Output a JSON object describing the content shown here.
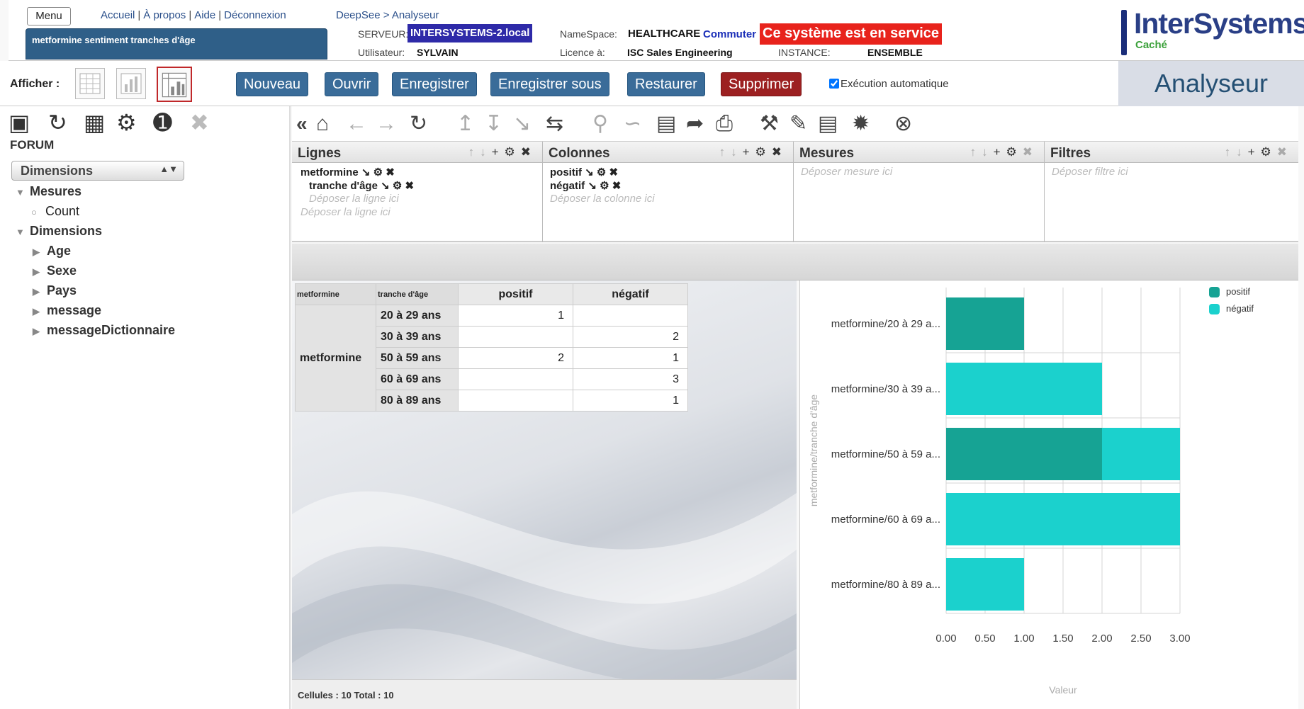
{
  "header": {
    "menu_label": "Menu",
    "links": [
      "Accueil",
      "À propos",
      "Aide",
      "Déconnexion"
    ],
    "title": "metformine sentiment tranches d'âge",
    "breadcrumb": "DeepSee > Analyseur",
    "server_label": "SERVEUR:",
    "server_value": "INTERSYSTEMS-2.local",
    "namespace_label": "NameSpace:",
    "namespace_value": "HEALTHCARE",
    "switch_label": "Commuter",
    "service_badge": "Ce système est en service",
    "user_label": "Utilisateur:",
    "user_value": "SYLVAIN",
    "license_label": "Licence à:",
    "license_value": "ISC Sales Engineering",
    "instance_label": "INSTANCE:",
    "instance_value": "ENSEMBLE",
    "logo_text": "InterSystems",
    "logo_sub": "Caché"
  },
  "toolbar": {
    "afficher_label": "Afficher :",
    "buttons": [
      "Nouveau",
      "Ouvrir",
      "Enregistrer",
      "Enregistrer sous",
      "Restaurer",
      "Supprimer"
    ],
    "auto_exec_label": "Exécution automatique",
    "auto_exec_checked": true,
    "page_title": "Analyseur"
  },
  "left_panel": {
    "cube_name": "FORUM",
    "selector_value": "Dimensions",
    "tree": [
      {
        "label": "Mesures",
        "bold": true,
        "expanded": true,
        "level": 0
      },
      {
        "label": "Count",
        "bold": false,
        "level": 1,
        "icon": "measure-icon"
      },
      {
        "label": "Dimensions",
        "bold": true,
        "expanded": true,
        "level": 0
      },
      {
        "label": "Age",
        "bold": true,
        "level": 1
      },
      {
        "label": "Sexe",
        "bold": true,
        "level": 1
      },
      {
        "label": "Pays",
        "bold": true,
        "level": 1
      },
      {
        "label": "message",
        "bold": true,
        "level": 1
      },
      {
        "label": "messageDictionnaire",
        "bold": true,
        "level": 1
      }
    ]
  },
  "zones": {
    "rows": {
      "title": "Lignes",
      "items": [
        "metformine",
        "tranche d'âge"
      ],
      "hint_inner": "Déposer la ligne ici",
      "hint": "Déposer la ligne ici"
    },
    "columns": {
      "title": "Colonnes",
      "items": [
        "positif",
        "négatif"
      ],
      "hint": "Déposer la colonne ici"
    },
    "measures": {
      "title": "Mesures",
      "hint": "Déposer mesure ici"
    },
    "filters": {
      "title": "Filtres",
      "hint": "Déposer filtre ici"
    }
  },
  "pivot": {
    "header_row": "metformine",
    "header_sub": "tranche d'âge",
    "columns": [
      "positif",
      "négatif"
    ],
    "group": "metformine",
    "rows": [
      {
        "label": "20 à 29 ans",
        "positif": "1",
        "negatif": ""
      },
      {
        "label": "30 à 39 ans",
        "positif": "",
        "negatif": "2"
      },
      {
        "label": "50 à 59 ans",
        "positif": "2",
        "negatif": "1"
      },
      {
        "label": "60 à 69 ans",
        "positif": "",
        "negatif": "3"
      },
      {
        "label": "80 à 89 ans",
        "positif": "",
        "negatif": "1"
      }
    ],
    "footer": "Cellules : 10   Total : 10"
  },
  "chart_data": {
    "type": "bar",
    "orientation": "horizontal",
    "stacked": true,
    "categories": [
      "metformine/20 à 29 a...",
      "metformine/30 à 39 a...",
      "metformine/50 à 59 a...",
      "metformine/60 à 69 a...",
      "metformine/80 à 89 a..."
    ],
    "series": [
      {
        "name": "positif",
        "values": [
          1,
          0,
          2,
          0,
          0
        ],
        "color": "#16a394"
      },
      {
        "name": "négatif",
        "values": [
          0,
          2,
          1,
          3,
          1
        ],
        "color": "#1bd1cd"
      }
    ],
    "xlabel": "Valeur",
    "ylabel": "metformine/tranche d'âge",
    "ticks": [
      "0.00",
      "0.50",
      "1.00",
      "1.50",
      "2.00",
      "2.50",
      "3.00"
    ],
    "xlim": [
      0,
      3
    ],
    "grid": true,
    "legend": "top-right"
  }
}
